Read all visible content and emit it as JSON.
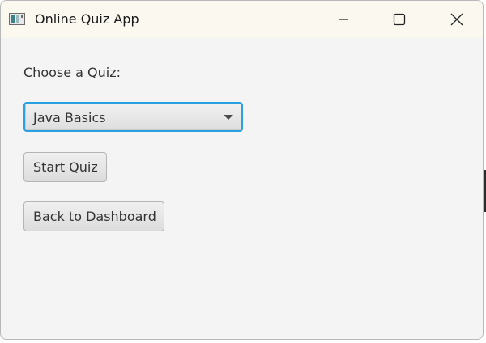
{
  "window": {
    "title": "Online Quiz App",
    "controls": {
      "minimize_icon": "minimize-icon",
      "maximize_icon": "maximize-icon",
      "close_icon": "close-icon"
    }
  },
  "quiz_selector": {
    "label": "Choose a Quiz:",
    "selected": "Java Basics"
  },
  "buttons": {
    "start": "Start Quiz",
    "back": "Back to Dashboard"
  },
  "colors": {
    "focus_border": "#2aa1e0",
    "window_bg": "#f4f4f4",
    "titlebar_bg": "#fbf8f0"
  }
}
